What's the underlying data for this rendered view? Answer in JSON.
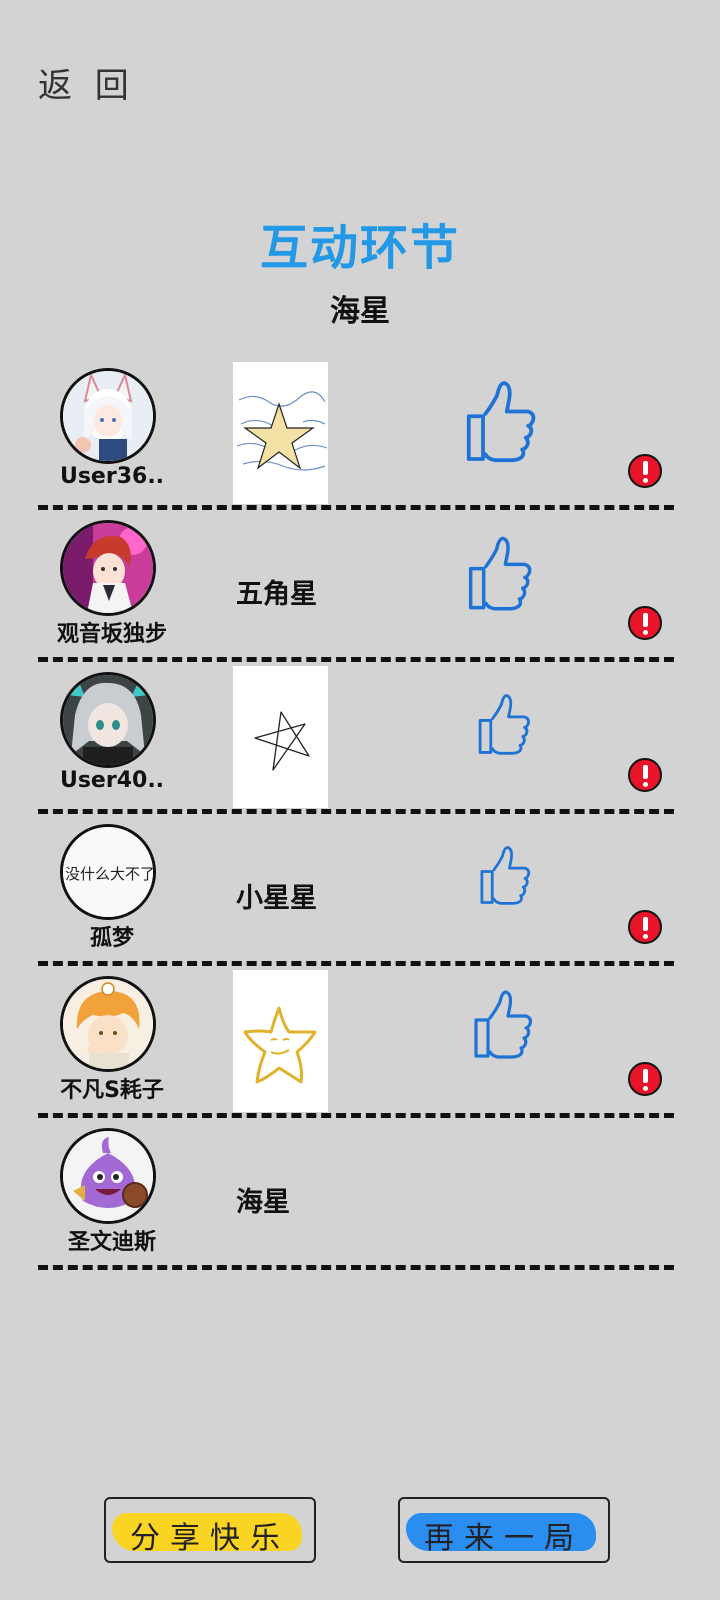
{
  "header": {
    "back_label": "返 回"
  },
  "title": "互动环节",
  "subtitle": "海星",
  "rows": [
    {
      "username": "User36..",
      "answer": "",
      "has_drawing": true,
      "drawing": "star-on-waves",
      "avatar": "white-haired-fox-girl"
    },
    {
      "username": "观音坂独步",
      "answer": "五角星",
      "has_drawing": false,
      "avatar": "red-haired-boy"
    },
    {
      "username": "User40..",
      "answer": "",
      "has_drawing": true,
      "drawing": "outline-star",
      "avatar": "silver-haired-girl"
    },
    {
      "username": "孤梦",
      "answer": "小星星",
      "has_drawing": false,
      "avatar": "handwritten-text"
    },
    {
      "username": "不凡S耗子",
      "answer": "",
      "has_drawing": true,
      "drawing": "smiling-star",
      "avatar": "orange-haired-boy"
    },
    {
      "username": "圣文迪斯",
      "answer": "海星",
      "has_drawing": false,
      "avatar": "purple-slime"
    }
  ],
  "avatar_text": {
    "handwritten": "没什么大不了"
  },
  "buttons": {
    "share_label": "分享快乐",
    "replay_label": "再来一局"
  },
  "colors": {
    "title": "#2298e6",
    "thumb": "#1f73d6",
    "report": "#e8142a",
    "share_fill": "#f9d423",
    "replay_fill": "#2a8ef0"
  },
  "icons": {
    "like": "thumbs-up-icon",
    "report": "exclamation-icon"
  }
}
